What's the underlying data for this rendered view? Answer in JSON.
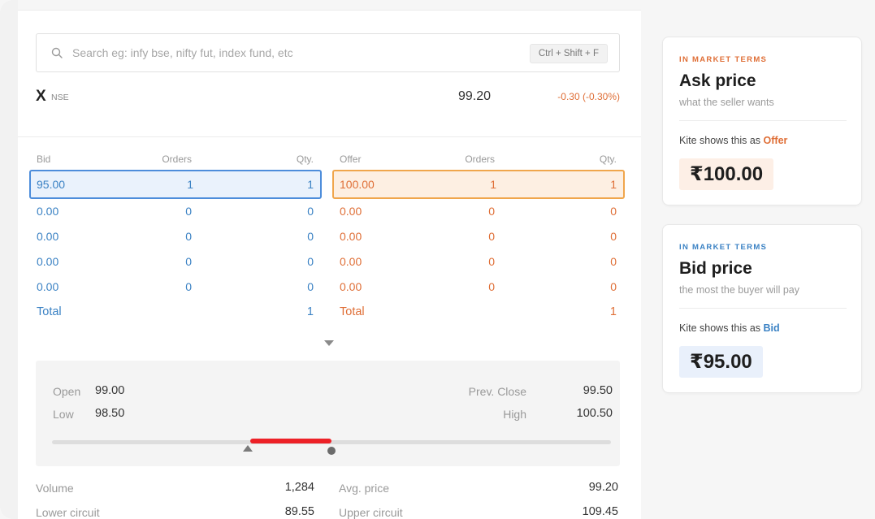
{
  "search": {
    "placeholder": "Search eg: infy bse, nifty fut, index fund, etc",
    "shortcut": "Ctrl + Shift + F"
  },
  "instrument": {
    "name": "X",
    "exchange": "NSE",
    "ltp": "99.20",
    "change": "-0.30 (-0.30%)"
  },
  "depth": {
    "bid": {
      "headers": [
        "Bid",
        "Orders",
        "Qty."
      ],
      "rows": [
        [
          "95.00",
          "1",
          "1"
        ],
        [
          "0.00",
          "0",
          "0"
        ],
        [
          "0.00",
          "0",
          "0"
        ],
        [
          "0.00",
          "0",
          "0"
        ],
        [
          "0.00",
          "0",
          "0"
        ]
      ],
      "total_label": "Total",
      "total_qty": "1"
    },
    "offer": {
      "headers": [
        "Offer",
        "Orders",
        "Qty."
      ],
      "rows": [
        [
          "100.00",
          "1",
          "1"
        ],
        [
          "0.00",
          "0",
          "0"
        ],
        [
          "0.00",
          "0",
          "0"
        ],
        [
          "0.00",
          "0",
          "0"
        ],
        [
          "0.00",
          "0",
          "0"
        ]
      ],
      "total_label": "Total",
      "total_qty": "1"
    }
  },
  "ohlc": {
    "open_label": "Open",
    "open": "99.00",
    "low_label": "Low",
    "low": "98.50",
    "prev_close_label": "Prev. Close",
    "prev_close": "99.50",
    "high_label": "High",
    "high": "100.50",
    "range_bar_start": 0.355,
    "range_bar_end": 0.5,
    "tri_marker": 0.35,
    "dot_marker": 0.5
  },
  "stats": {
    "volume_label": "Volume",
    "volume": "1,284",
    "avg_label": "Avg. price",
    "avg": "99.20",
    "lower_circuit_label": "Lower circuit",
    "lower_circuit": "89.55",
    "upper_circuit_label": "Upper circuit",
    "upper_circuit": "109.45"
  },
  "cards": {
    "ask": {
      "eyebrow": "IN MARKET TERMS",
      "title": "Ask price",
      "sub": "what the seller wants",
      "shows_prefix": "Kite shows this as ",
      "shows_term": "Offer",
      "price": "₹100.00"
    },
    "bid": {
      "eyebrow": "IN MARKET TERMS",
      "title": "Bid price",
      "sub": "the most the buyer will pay",
      "shows_prefix": "Kite shows this as ",
      "shows_term": "Bid",
      "price": "₹95.00"
    }
  },
  "colors": {
    "bid": "#3b82c4",
    "offer": "#df6e36",
    "bid_bg": "#eaf2fc",
    "offer_bg": "#fdefe2",
    "range_bar": "#ed2127"
  }
}
